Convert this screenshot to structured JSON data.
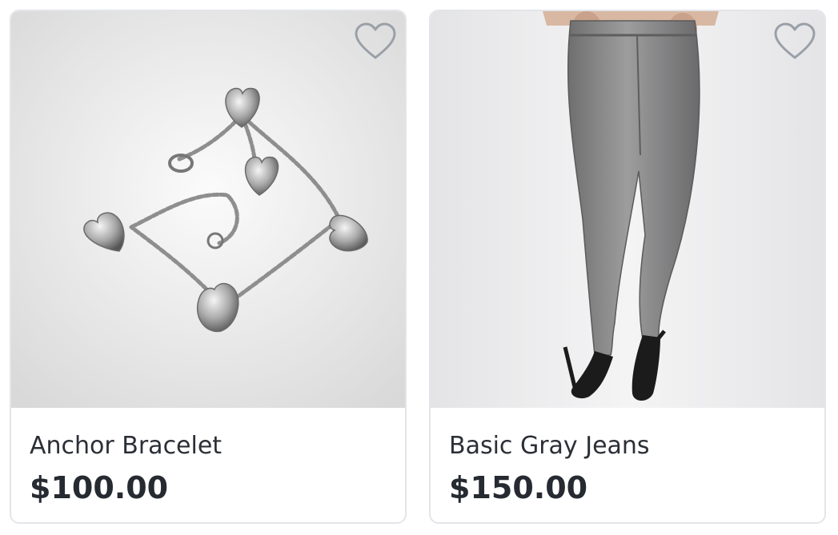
{
  "products": [
    {
      "name": "Anchor Bracelet",
      "price": "$100.00",
      "image_subject": "silver heart charm bracelet",
      "favorite_icon": "heart-outline-icon"
    },
    {
      "name": "Basic Gray Jeans",
      "price": "$150.00",
      "image_subject": "model wearing gray skinny jeans and black heels",
      "favorite_icon": "heart-outline-icon"
    }
  ],
  "colors": {
    "card_border": "#e3e5ea",
    "icon_stroke": "#9aa0a8",
    "text": "#2b2f36"
  }
}
